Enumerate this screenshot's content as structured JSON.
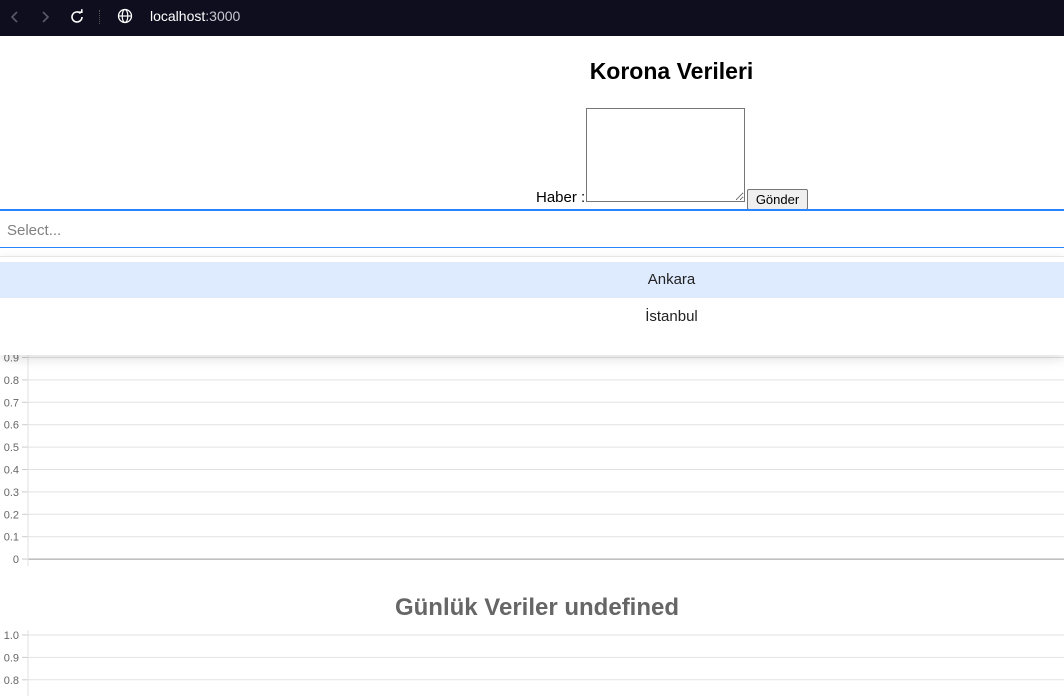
{
  "browser": {
    "url_host": "localhost",
    "url_port": ":3000",
    "icons": [
      "back-arrow-icon",
      "forward-arrow-icon",
      "reload-icon",
      "globe-icon"
    ]
  },
  "page": {
    "title": "Korona Verileri",
    "haber_label": "Haber :",
    "send_label": "Gönder"
  },
  "select": {
    "placeholder": "Select...",
    "options": [
      "Ankara",
      "İstanbul"
    ],
    "highlighted_option": "Ankara",
    "focus_color": "#2684ff",
    "highlight_color": "#deebff"
  },
  "chart_data": [
    {
      "type": "line",
      "title": "",
      "ylim": [
        0,
        0.9
      ],
      "yticks": [
        "0",
        "0.1",
        "0.2",
        "0.3",
        "0.4",
        "0.5",
        "0.6",
        "0.7",
        "0.8",
        "0.9"
      ],
      "series": [],
      "grid": true
    },
    {
      "type": "line",
      "title": "Günlük Veriler  undefined",
      "ylim": [
        0,
        1.0
      ],
      "yticks": [
        "1.0",
        "0.9",
        "0.8"
      ],
      "series": [],
      "grid": true
    }
  ]
}
